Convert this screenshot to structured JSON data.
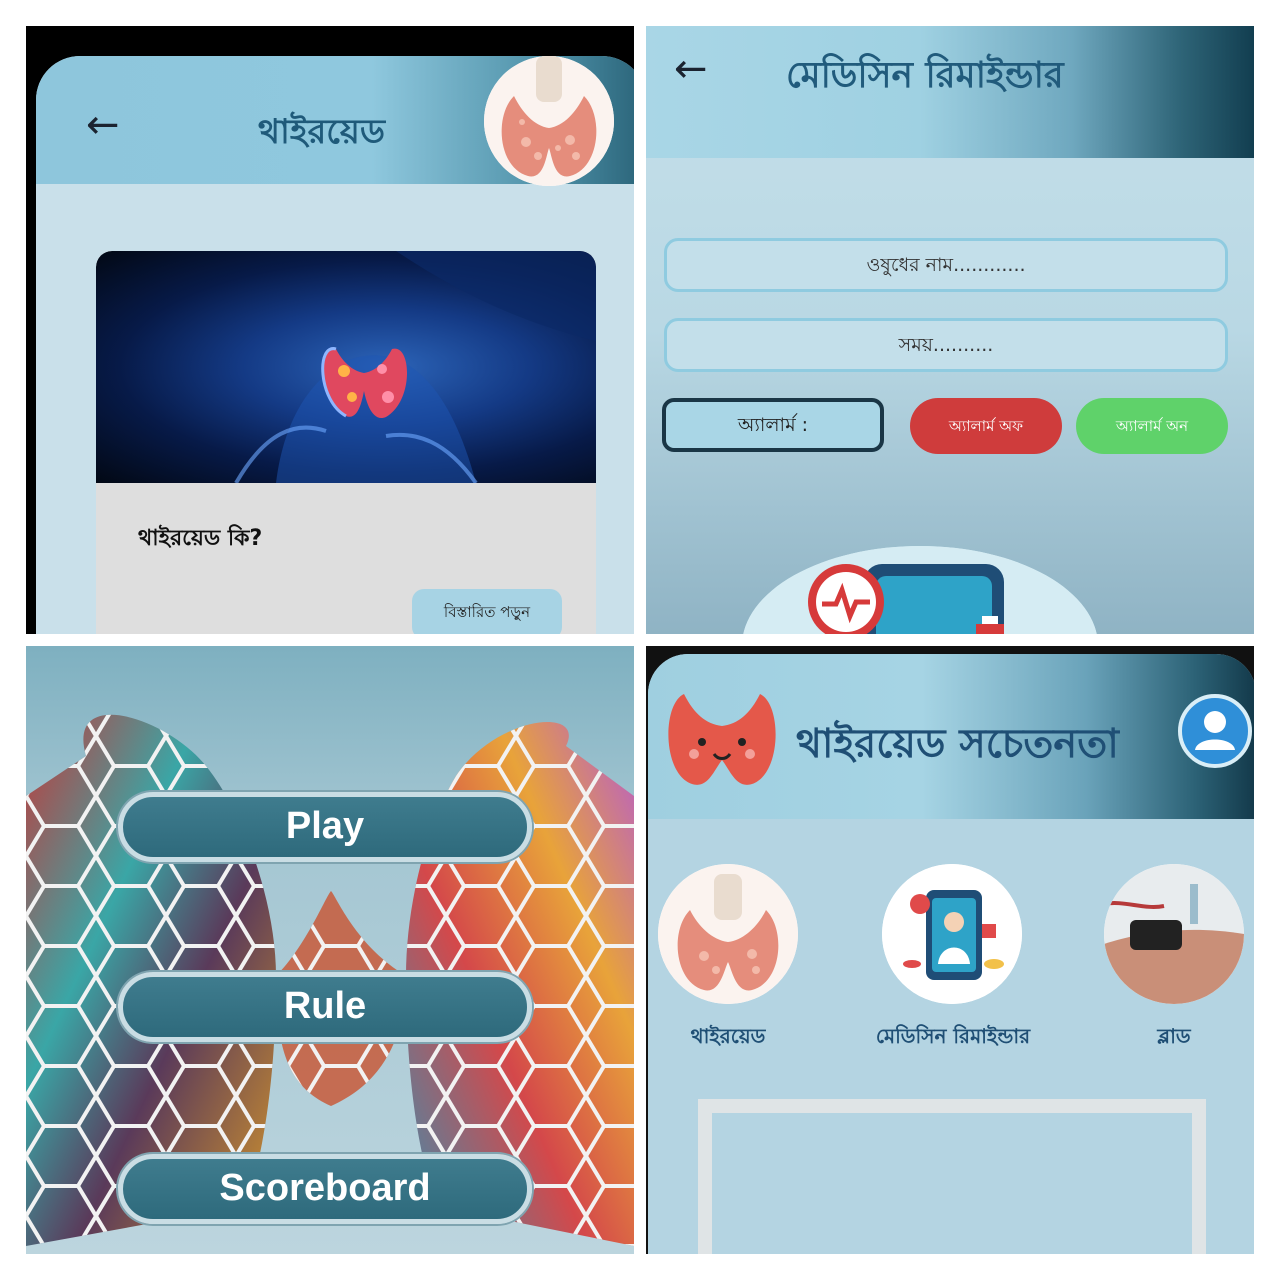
{
  "thyroid_screen": {
    "title": "থাইরয়েড",
    "question": "থাইরয়েড কি?",
    "read_more_label": "বিস্তারিত পড়ুন"
  },
  "reminder_screen": {
    "title": "মেডিসিন রিমাইন্ডার",
    "medicine_name_placeholder": "ওষুধের নাম............",
    "time_placeholder": "সময়..........",
    "alarm_label": "অ্যালার্ম :",
    "alarm_off_label": "অ্যালার্ম অফ",
    "alarm_on_label": "অ্যালার্ম অন"
  },
  "game_menu": {
    "buttons": [
      "Play",
      "Rule",
      "Scoreboard"
    ]
  },
  "home_screen": {
    "title": "থাইরয়েড সচেতনতা",
    "features": [
      {
        "label": "থাইরয়েড"
      },
      {
        "label": "মেডিসিন রিমাইন্ডার"
      },
      {
        "label": "ব্লাড"
      }
    ]
  },
  "colors": {
    "header_dark": "#13394a",
    "header_light": "#9fcfe0",
    "title_text": "#1f4f75",
    "alarm_off": "#cf3c3c",
    "alarm_on": "#5fd26a",
    "menu_button": "#2e6a7c"
  }
}
